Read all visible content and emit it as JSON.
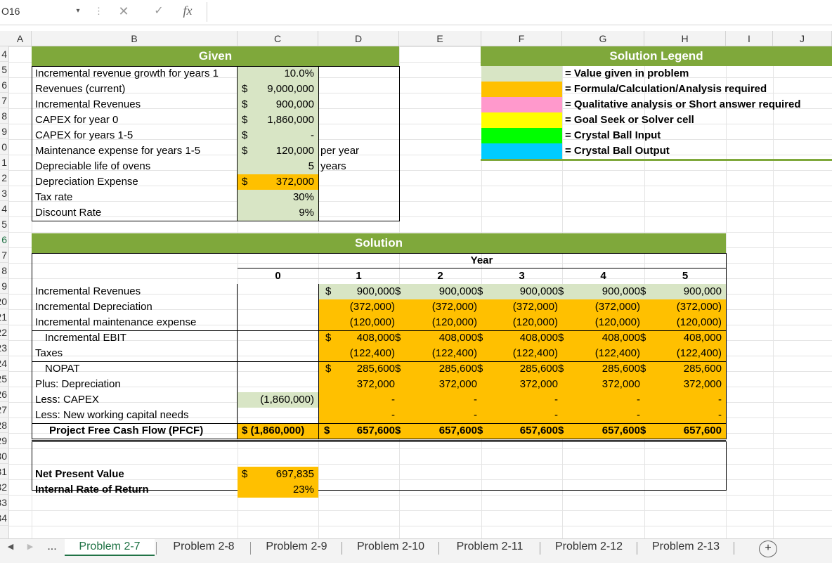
{
  "formula_bar": {
    "cell_ref": "O16",
    "fx": "fx",
    "value": ""
  },
  "columns": [
    "A",
    "B",
    "C",
    "D",
    "E",
    "F",
    "G",
    "H",
    "I",
    "J"
  ],
  "rows": [
    "4",
    "5",
    "6",
    "7",
    "8",
    "9",
    "0",
    "1",
    "2",
    "3",
    "4",
    "5",
    "6",
    "7",
    "8",
    "9",
    "20",
    "21",
    "22",
    "23",
    "24",
    "25",
    "26",
    "27",
    "28",
    "29",
    "30",
    "31",
    "32",
    "33",
    "34"
  ],
  "given": {
    "title": "Given",
    "items": [
      {
        "label": "Incremental revenue growth for years 1",
        "dollar": "",
        "value": "10.0%",
        "unit": ""
      },
      {
        "label": "Revenues (current)",
        "dollar": "$",
        "value": "9,000,000",
        "unit": ""
      },
      {
        "label": "Incremental Revenues",
        "dollar": "$",
        "value": "900,000",
        "unit": ""
      },
      {
        "label": "CAPEX for year 0",
        "dollar": "$",
        "value": "1,860,000",
        "unit": ""
      },
      {
        "label": "CAPEX for years 1-5",
        "dollar": "$",
        "value": "-",
        "unit": ""
      },
      {
        "label": "Maintenance expense for years 1-5",
        "dollar": "$",
        "value": "120,000",
        "unit": "per year"
      },
      {
        "label": "Depreciable life of ovens",
        "dollar": "",
        "value": "5",
        "unit": "years"
      },
      {
        "label": "Depreciation Expense",
        "dollar": "$",
        "value": "372,000",
        "unit": ""
      },
      {
        "label": "Tax rate",
        "dollar": "",
        "value": "30%",
        "unit": ""
      },
      {
        "label": "Discount Rate",
        "dollar": "",
        "value": "9%",
        "unit": ""
      }
    ]
  },
  "legend": {
    "title": "Solution Legend",
    "items": [
      {
        "color": "#d8e5c5",
        "text": "= Value given in problem"
      },
      {
        "color": "#ffc000",
        "text": "= Formula/Calculation/Analysis required"
      },
      {
        "color": "#ff99cc",
        "text": "= Qualitative analysis or Short answer required"
      },
      {
        "color": "#ffff00",
        "text": "= Goal Seek or Solver cell"
      },
      {
        "color": "#00ff00",
        "text": "= Crystal Ball Input"
      },
      {
        "color": "#00ccff",
        "text": "= Crystal Ball Output"
      }
    ]
  },
  "solution": {
    "title": "Solution",
    "year_label": "Year",
    "years": [
      "0",
      "1",
      "2",
      "3",
      "4",
      "5"
    ],
    "rows": [
      {
        "label": "Incremental Revenues",
        "indent": false,
        "bold": false,
        "c": "",
        "vals": [
          "900,000",
          "900,000",
          "900,000",
          "900,000",
          "900,000"
        ],
        "dollar": true
      },
      {
        "label": "Incremental Depreciation",
        "indent": false,
        "bold": false,
        "c": "",
        "vals": [
          "(372,000)",
          "(372,000)",
          "(372,000)",
          "(372,000)",
          "(372,000)"
        ],
        "dollar": false
      },
      {
        "label": "Incremental maintenance expense",
        "indent": false,
        "bold": false,
        "c": "",
        "vals": [
          "(120,000)",
          "(120,000)",
          "(120,000)",
          "(120,000)",
          "(120,000)"
        ],
        "dollar": false
      },
      {
        "label": "Incremental EBIT",
        "indent": true,
        "bold": false,
        "c": "",
        "vals": [
          "408,000",
          "408,000",
          "408,000",
          "408,000",
          "408,000"
        ],
        "dollar": true
      },
      {
        "label": "Taxes",
        "indent": false,
        "bold": false,
        "c": "",
        "vals": [
          "(122,400)",
          "(122,400)",
          "(122,400)",
          "(122,400)",
          "(122,400)"
        ],
        "dollar": false
      },
      {
        "label": "NOPAT",
        "indent": true,
        "bold": false,
        "c": "",
        "vals": [
          "285,600",
          "285,600",
          "285,600",
          "285,600",
          "285,600"
        ],
        "dollar": true
      },
      {
        "label": "Plus:  Depreciation",
        "indent": false,
        "bold": false,
        "c": "",
        "vals": [
          "372,000",
          "372,000",
          "372,000",
          "372,000",
          "372,000"
        ],
        "dollar": false
      },
      {
        "label": "Less:  CAPEX",
        "indent": false,
        "bold": false,
        "c": "(1,860,000)",
        "vals": [
          "-",
          "-",
          "-",
          "-",
          "-"
        ],
        "dollar": false
      },
      {
        "label": "Less:  New working capital needs",
        "indent": false,
        "bold": false,
        "c": "",
        "vals": [
          "-",
          "-",
          "-",
          "-",
          "-"
        ],
        "dollar": false
      },
      {
        "label": "Project Free Cash Flow (PFCF)",
        "indent": true,
        "bold": true,
        "c": "$ (1,860,000)",
        "vals": [
          "657,600",
          "657,600",
          "657,600",
          "657,600",
          "657,600"
        ],
        "dollar": true
      }
    ],
    "npv_label": "Net Present Value",
    "npv_dollar": "$",
    "npv_value": "697,835",
    "irr_label": "Internal Rate of Return",
    "irr_value": "23%"
  },
  "tabs": [
    "Problem 2-7",
    "Problem 2-8",
    "Problem 2-9",
    "Problem 2-10",
    "Problem 2-11",
    "Problem 2-12",
    "Problem 2-13"
  ],
  "tab_controls": {
    "prev": "◀",
    "next": "▶",
    "more": "...",
    "add": "+"
  }
}
